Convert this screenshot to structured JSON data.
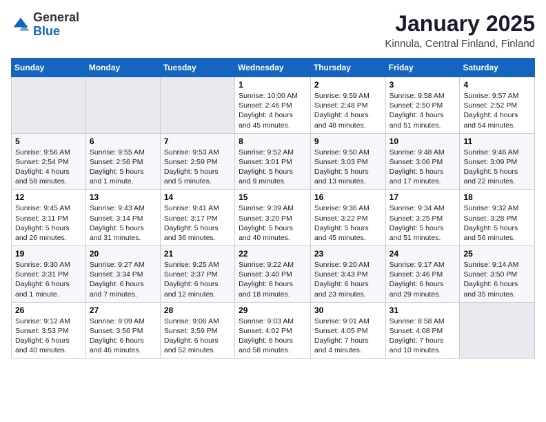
{
  "header": {
    "logo_general": "General",
    "logo_blue": "Blue",
    "month_title": "January 2025",
    "location": "Kinnula, Central Finland, Finland"
  },
  "days_of_week": [
    "Sunday",
    "Monday",
    "Tuesday",
    "Wednesday",
    "Thursday",
    "Friday",
    "Saturday"
  ],
  "weeks": [
    [
      {
        "day": "",
        "info": ""
      },
      {
        "day": "",
        "info": ""
      },
      {
        "day": "",
        "info": ""
      },
      {
        "day": "1",
        "info": "Sunrise: 10:00 AM\nSunset: 2:46 PM\nDaylight: 4 hours and 45 minutes."
      },
      {
        "day": "2",
        "info": "Sunrise: 9:59 AM\nSunset: 2:48 PM\nDaylight: 4 hours and 48 minutes."
      },
      {
        "day": "3",
        "info": "Sunrise: 9:58 AM\nSunset: 2:50 PM\nDaylight: 4 hours and 51 minutes."
      },
      {
        "day": "4",
        "info": "Sunrise: 9:57 AM\nSunset: 2:52 PM\nDaylight: 4 hours and 54 minutes."
      }
    ],
    [
      {
        "day": "5",
        "info": "Sunrise: 9:56 AM\nSunset: 2:54 PM\nDaylight: 4 hours and 58 minutes."
      },
      {
        "day": "6",
        "info": "Sunrise: 9:55 AM\nSunset: 2:56 PM\nDaylight: 5 hours and 1 minute."
      },
      {
        "day": "7",
        "info": "Sunrise: 9:53 AM\nSunset: 2:59 PM\nDaylight: 5 hours and 5 minutes."
      },
      {
        "day": "8",
        "info": "Sunrise: 9:52 AM\nSunset: 3:01 PM\nDaylight: 5 hours and 9 minutes."
      },
      {
        "day": "9",
        "info": "Sunrise: 9:50 AM\nSunset: 3:03 PM\nDaylight: 5 hours and 13 minutes."
      },
      {
        "day": "10",
        "info": "Sunrise: 9:48 AM\nSunset: 3:06 PM\nDaylight: 5 hours and 17 minutes."
      },
      {
        "day": "11",
        "info": "Sunrise: 9:46 AM\nSunset: 3:09 PM\nDaylight: 5 hours and 22 minutes."
      }
    ],
    [
      {
        "day": "12",
        "info": "Sunrise: 9:45 AM\nSunset: 3:11 PM\nDaylight: 5 hours and 26 minutes."
      },
      {
        "day": "13",
        "info": "Sunrise: 9:43 AM\nSunset: 3:14 PM\nDaylight: 5 hours and 31 minutes."
      },
      {
        "day": "14",
        "info": "Sunrise: 9:41 AM\nSunset: 3:17 PM\nDaylight: 5 hours and 36 minutes."
      },
      {
        "day": "15",
        "info": "Sunrise: 9:39 AM\nSunset: 3:20 PM\nDaylight: 5 hours and 40 minutes."
      },
      {
        "day": "16",
        "info": "Sunrise: 9:36 AM\nSunset: 3:22 PM\nDaylight: 5 hours and 45 minutes."
      },
      {
        "day": "17",
        "info": "Sunrise: 9:34 AM\nSunset: 3:25 PM\nDaylight: 5 hours and 51 minutes."
      },
      {
        "day": "18",
        "info": "Sunrise: 9:32 AM\nSunset: 3:28 PM\nDaylight: 5 hours and 56 minutes."
      }
    ],
    [
      {
        "day": "19",
        "info": "Sunrise: 9:30 AM\nSunset: 3:31 PM\nDaylight: 6 hours and 1 minute."
      },
      {
        "day": "20",
        "info": "Sunrise: 9:27 AM\nSunset: 3:34 PM\nDaylight: 6 hours and 7 minutes."
      },
      {
        "day": "21",
        "info": "Sunrise: 9:25 AM\nSunset: 3:37 PM\nDaylight: 6 hours and 12 minutes."
      },
      {
        "day": "22",
        "info": "Sunrise: 9:22 AM\nSunset: 3:40 PM\nDaylight: 6 hours and 18 minutes."
      },
      {
        "day": "23",
        "info": "Sunrise: 9:20 AM\nSunset: 3:43 PM\nDaylight: 6 hours and 23 minutes."
      },
      {
        "day": "24",
        "info": "Sunrise: 9:17 AM\nSunset: 3:46 PM\nDaylight: 6 hours and 29 minutes."
      },
      {
        "day": "25",
        "info": "Sunrise: 9:14 AM\nSunset: 3:50 PM\nDaylight: 6 hours and 35 minutes."
      }
    ],
    [
      {
        "day": "26",
        "info": "Sunrise: 9:12 AM\nSunset: 3:53 PM\nDaylight: 6 hours and 40 minutes."
      },
      {
        "day": "27",
        "info": "Sunrise: 9:09 AM\nSunset: 3:56 PM\nDaylight: 6 hours and 46 minutes."
      },
      {
        "day": "28",
        "info": "Sunrise: 9:06 AM\nSunset: 3:59 PM\nDaylight: 6 hours and 52 minutes."
      },
      {
        "day": "29",
        "info": "Sunrise: 9:03 AM\nSunset: 4:02 PM\nDaylight: 6 hours and 58 minutes."
      },
      {
        "day": "30",
        "info": "Sunrise: 9:01 AM\nSunset: 4:05 PM\nDaylight: 7 hours and 4 minutes."
      },
      {
        "day": "31",
        "info": "Sunrise: 8:58 AM\nSunset: 4:08 PM\nDaylight: 7 hours and 10 minutes."
      },
      {
        "day": "",
        "info": ""
      }
    ]
  ]
}
